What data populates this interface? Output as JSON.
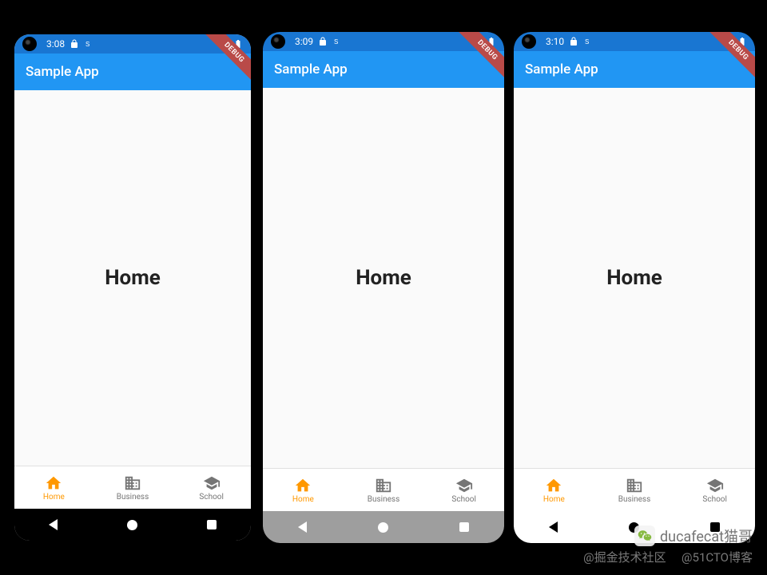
{
  "app_title": "Sample App",
  "body_label": "Home",
  "debug_banner": "DEBUG",
  "nav": {
    "home": "Home",
    "business": "Business",
    "school": "School"
  },
  "phones": [
    {
      "time": "3:08",
      "sys_nav_style": "black",
      "rounded": false,
      "bezel": true
    },
    {
      "time": "3:09",
      "sys_nav_style": "gray",
      "rounded": true,
      "bezel": false
    },
    {
      "time": "3:10",
      "sys_nav_style": "white",
      "rounded": true,
      "bezel": false
    }
  ],
  "watermark": {
    "line1": "ducafecat猫哥",
    "line2_prefix": "@掘金技术社区",
    "line2_suffix": "@51CTO博客"
  }
}
